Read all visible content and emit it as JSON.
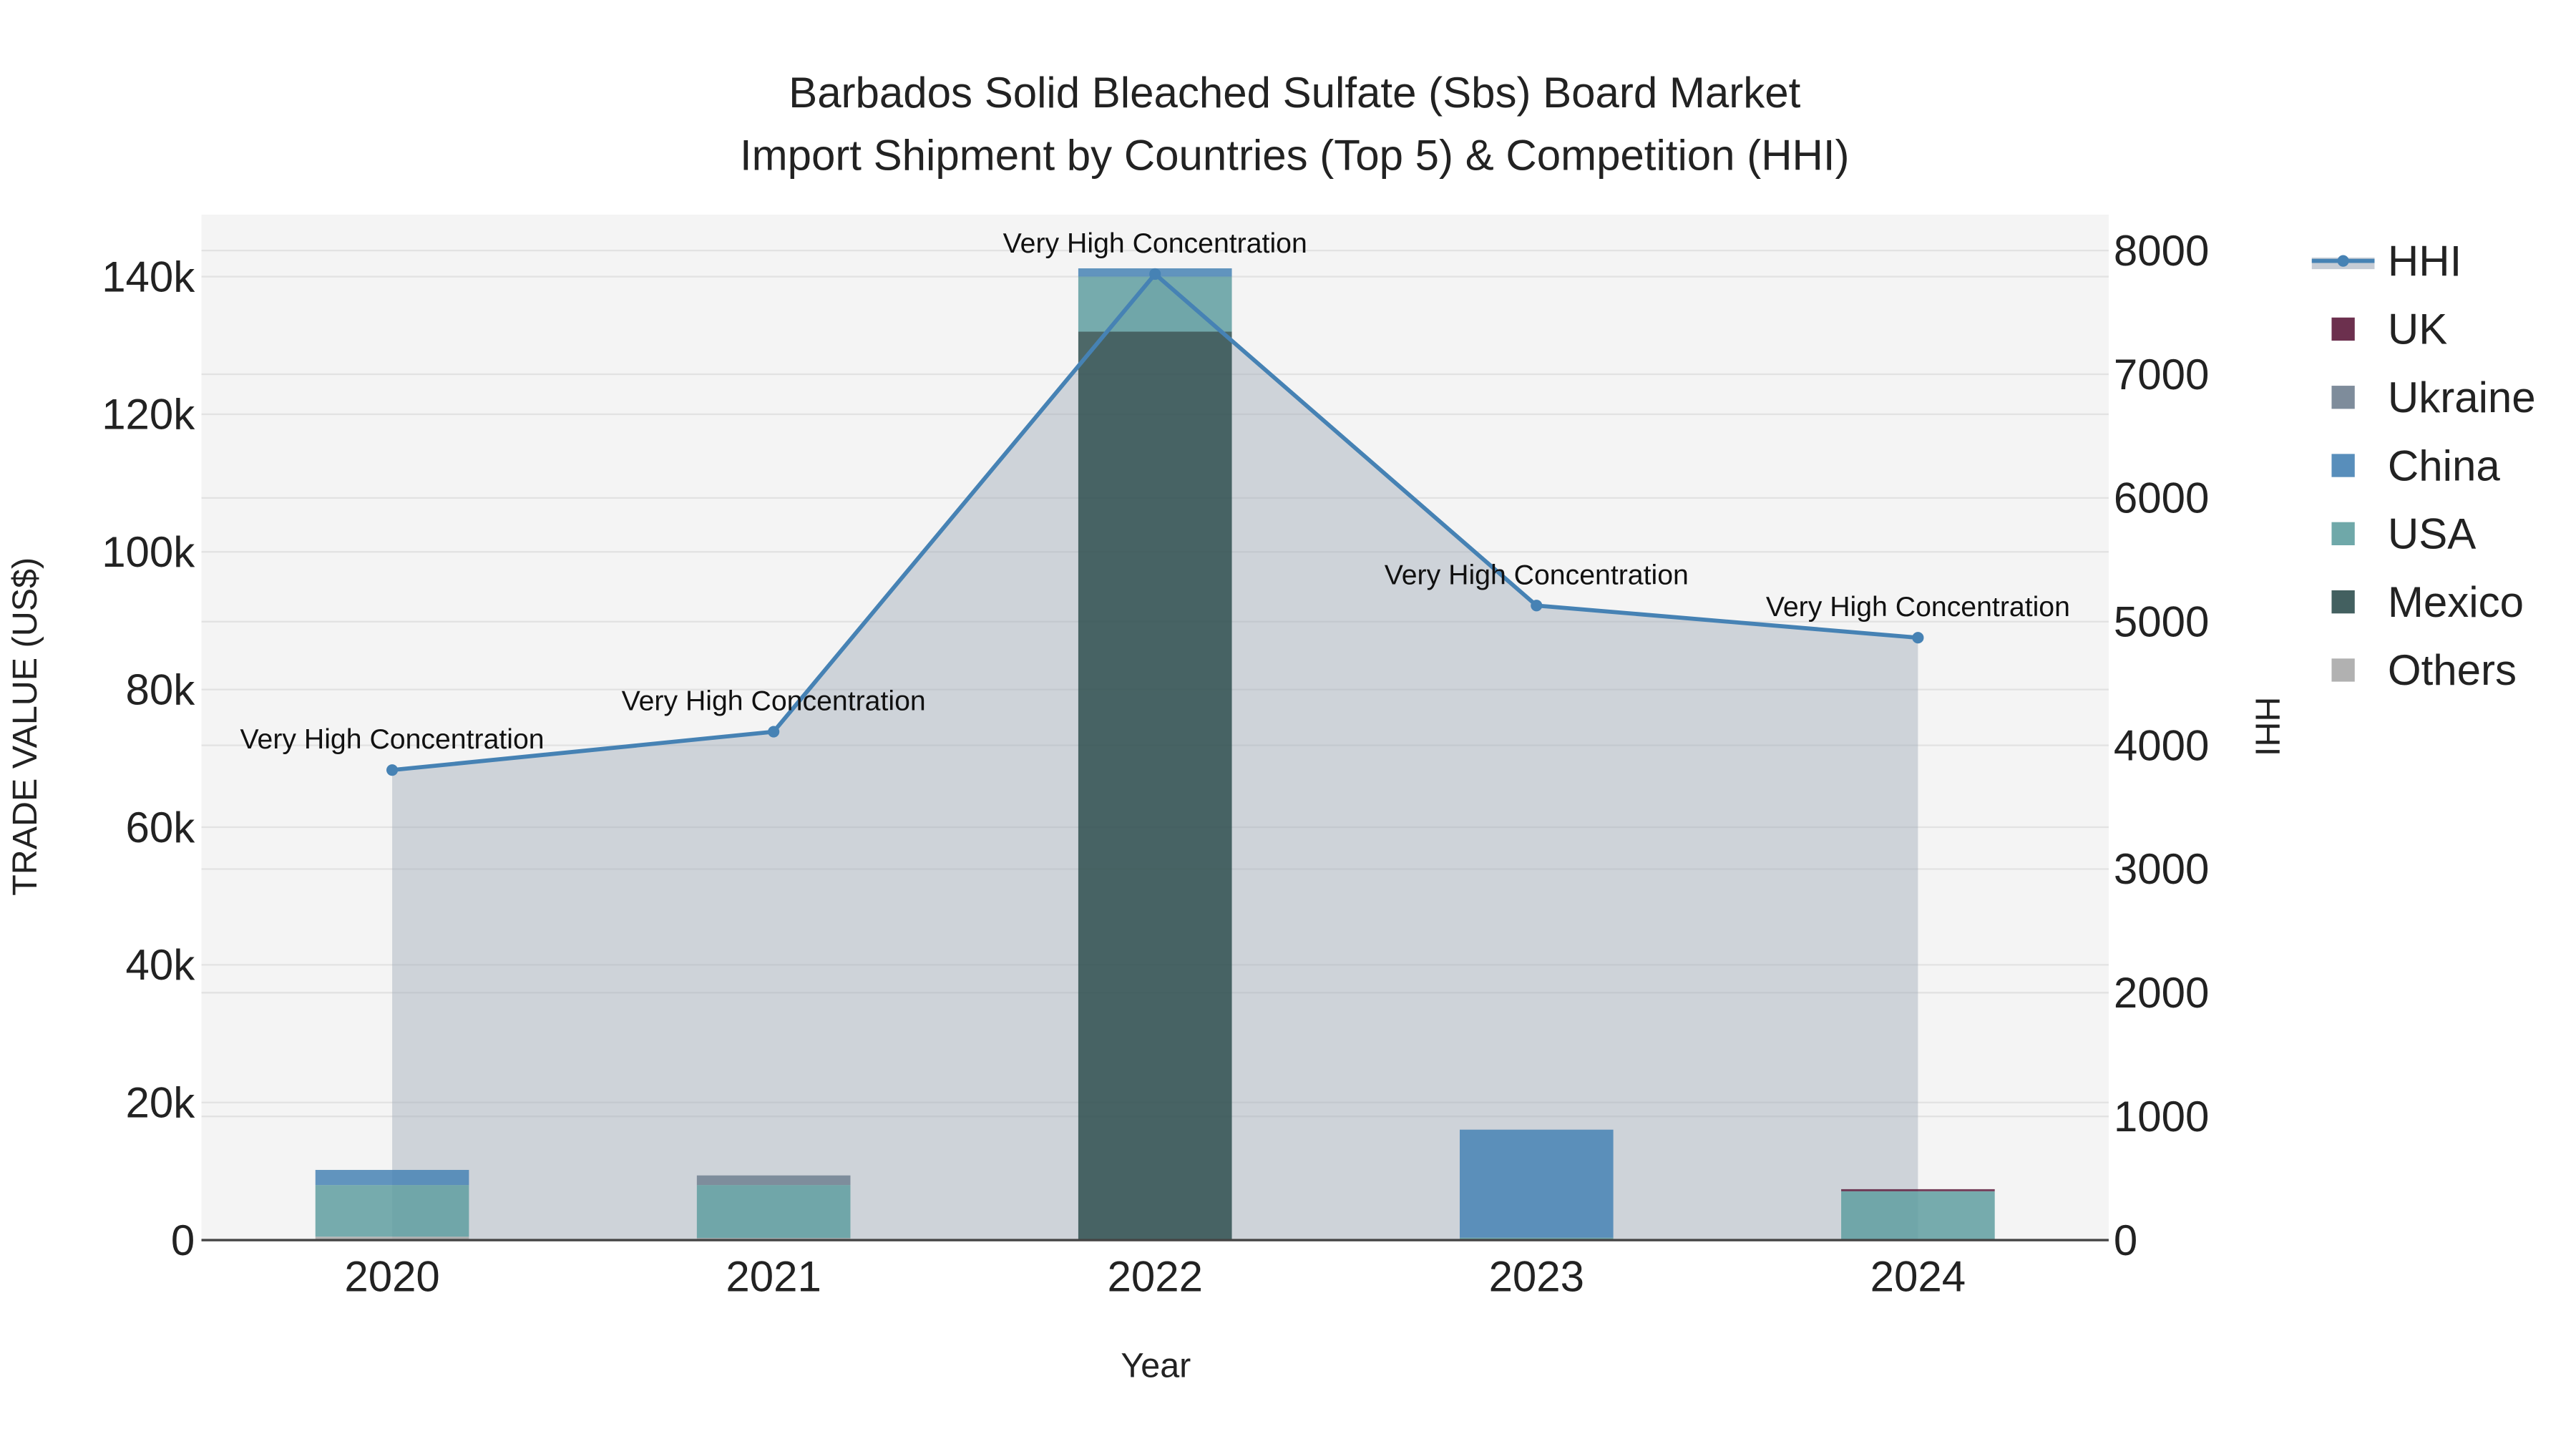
{
  "chart_data": {
    "type": "bar",
    "title_line1": "Barbados Solid Bleached Sulfate (Sbs) Board Market",
    "title_line2": "Import Shipment by Countries (Top 5) & Competition (HHI)",
    "xlabel": "Year",
    "ylabel": "TRADE VALUE (US$)",
    "y2label": "HHI",
    "categories": [
      "2020",
      "2021",
      "2022",
      "2023",
      "2024"
    ],
    "ylim": [
      0,
      149000
    ],
    "y2lim": [
      0,
      8290
    ],
    "yticks": [
      0,
      20000,
      40000,
      60000,
      80000,
      100000,
      120000,
      140000
    ],
    "ytick_labels": [
      "0",
      "20k",
      "40k",
      "60k",
      "80k",
      "100k",
      "120k",
      "140k"
    ],
    "y2ticks": [
      0,
      1000,
      2000,
      3000,
      4000,
      5000,
      6000,
      7000,
      8000
    ],
    "y2tick_labels": [
      "0",
      "1000",
      "2000",
      "3000",
      "4000",
      "5000",
      "6000",
      "7000",
      "8000"
    ],
    "series": [
      {
        "name": "Others",
        "color": "#a9a9a9",
        "values": [
          500,
          300,
          0,
          0,
          0
        ]
      },
      {
        "name": "Mexico",
        "color": "#2f4f4f",
        "values": [
          0,
          0,
          132000,
          0,
          0
        ]
      },
      {
        "name": "USA",
        "color": "#5f9ea0",
        "values": [
          7500,
          7700,
          8000,
          350,
          7100
        ]
      },
      {
        "name": "China",
        "color": "#4682b4",
        "values": [
          2200,
          0,
          1200,
          15700,
          0
        ]
      },
      {
        "name": "Ukraine",
        "color": "#708090",
        "values": [
          0,
          1400,
          0,
          0,
          0
        ]
      },
      {
        "name": "UK",
        "color": "#5c1a3b",
        "values": [
          0,
          0,
          0,
          0,
          300
        ]
      }
    ],
    "hhi": {
      "name": "HHI",
      "color": "#4682b4",
      "values": [
        3800,
        4110,
        7810,
        5130,
        4870
      ],
      "annotations": [
        "Very High Concentration",
        "Very High Concentration",
        "Very High Concentration",
        "Very High Concentration",
        "Very High Concentration"
      ]
    },
    "legend_order": [
      "HHI",
      "UK",
      "Ukraine",
      "China",
      "USA",
      "Mexico",
      "Others"
    ],
    "legend_position": "right",
    "grid": true
  }
}
